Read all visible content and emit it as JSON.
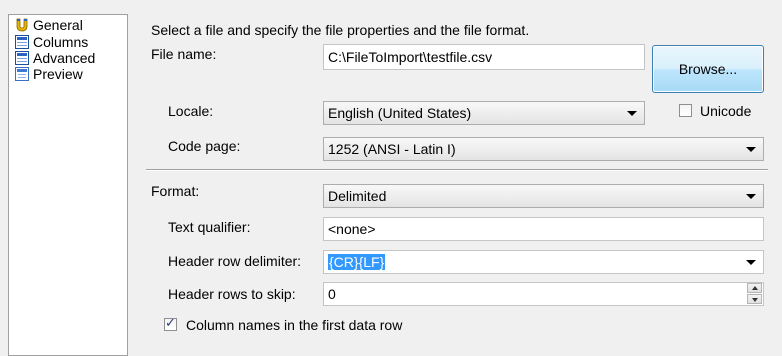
{
  "sidebar": {
    "items": [
      {
        "label": "General",
        "icon": "general-icon",
        "selected": true
      },
      {
        "label": "Columns",
        "icon": "grid-icon"
      },
      {
        "label": "Advanced",
        "icon": "grid-icon"
      },
      {
        "label": "Preview",
        "icon": "preview-icon"
      }
    ]
  },
  "instructions": "Select a file and specify the file properties and the file format.",
  "file": {
    "label": "File name:",
    "value": "C:\\FileToImport\\testfile.csv",
    "browse_label": "Browse..."
  },
  "locale": {
    "label": "Locale:",
    "value": "English (United States)"
  },
  "unicode": {
    "label": "Unicode",
    "checked": false
  },
  "code_page": {
    "label": "Code page:",
    "value": "1252  (ANSI - Latin I)"
  },
  "format": {
    "label": "Format:",
    "value": "Delimited"
  },
  "text_qualifier": {
    "label": "Text qualifier:",
    "value": "<none>"
  },
  "header_row_delimiter": {
    "label": "Header row delimiter:",
    "value": "{CR}{LF}"
  },
  "header_rows_to_skip": {
    "label": "Header rows to skip:",
    "value": "0"
  },
  "column_names": {
    "label": "Column names in the first data row",
    "checked": true
  },
  "colors": {
    "selection": "#3399ff",
    "button_border": "#3c7fb1"
  }
}
